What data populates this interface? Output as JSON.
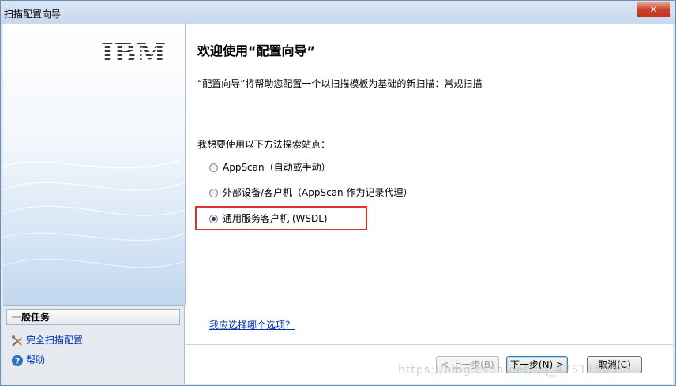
{
  "window": {
    "title": "扫描配置向导",
    "close_label": "✕"
  },
  "left": {
    "logo_text": "IBM",
    "tasks_header": "一般任务",
    "tasks": [
      {
        "label": "完全扫描配置",
        "icon": "tools-icon"
      },
      {
        "label": "帮助",
        "icon": "help-icon"
      }
    ]
  },
  "main": {
    "heading": "欢迎使用“配置向导”",
    "description": "“配置向导”将帮助您配置一个以扫描模板为基础的新扫描：常规扫描",
    "question": "我想要使用以下方法探索站点：",
    "options": [
      {
        "label": "AppScan（自动或手动）",
        "checked": false
      },
      {
        "label": "外部设备/客户机（AppScan 作为记录代理）",
        "checked": false
      },
      {
        "label": "通用服务客户机 (WSDL)",
        "checked": true
      }
    ],
    "help_link": "我应选择哪个选项？"
  },
  "buttons": {
    "back": "< 上一步(B)",
    "next": "下一步(N) >",
    "cancel": "取消(C)"
  },
  "watermark": "https://blog.csdn.net/qq_42511509",
  "colors": {
    "highlight": "#e03030",
    "link": "#0033aa"
  }
}
